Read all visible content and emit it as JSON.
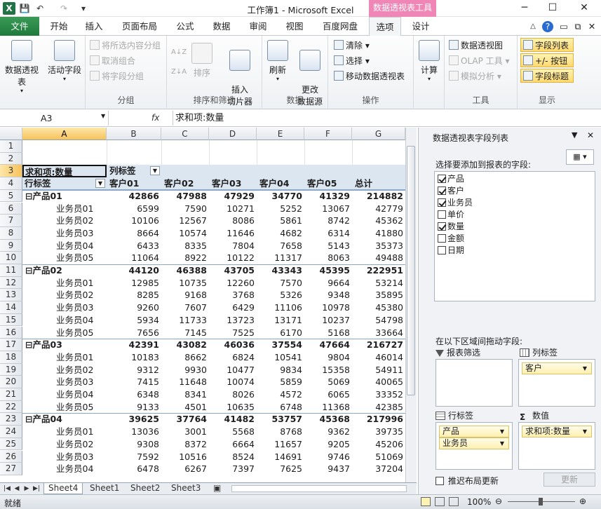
{
  "window": {
    "title": "工作簿1 - Microsoft Excel",
    "context_tab": "数据透视表工具",
    "win_min": "─",
    "win_max": "☐",
    "win_close": "✕"
  },
  "qat": {
    "save": "💾",
    "undo": "↶",
    "redo": "↷",
    "more": "▾"
  },
  "tabs": [
    "文件",
    "开始",
    "插入",
    "页面布局",
    "公式",
    "数据",
    "审阅",
    "视图",
    "百度网盘",
    "选项",
    "设计"
  ],
  "active_tab": "选项",
  "help_icons": [
    "△",
    "?",
    "▭",
    "⧉",
    "✕"
  ],
  "ribbon": {
    "pivot_table": {
      "label": "数据透视表"
    },
    "active_field": {
      "label": "活动字段"
    },
    "group": {
      "name": "分组",
      "items": [
        "将所选内容分组",
        "取消组合",
        "将字段分组"
      ]
    },
    "sort": {
      "name": "排序和筛选",
      "sort_label": "排序",
      "az": "A↓Z",
      "za": "Z↓A",
      "slicer": "插入\n切片器"
    },
    "data": {
      "name": "数据",
      "refresh": "刷新",
      "change_source": "更改\n数据源"
    },
    "ops": {
      "name": "操作",
      "items": [
        "清除",
        "选择",
        "移动数据透视表"
      ]
    },
    "calc": {
      "label": "计算"
    },
    "tools": {
      "name": "工具",
      "items": [
        "数据透视图",
        "OLAP 工具",
        "模拟分析"
      ]
    },
    "show": {
      "name": "显示",
      "items": [
        "字段列表",
        "+/- 按钮",
        "字段标题"
      ]
    }
  },
  "formula_bar": {
    "name_box": "A3",
    "fx": "fx",
    "formula": "求和项:数量"
  },
  "columns": [
    "A",
    "B",
    "C",
    "D",
    "E",
    "F",
    "G"
  ],
  "rows": [
    {
      "n": "1",
      "cells": []
    },
    {
      "n": "2",
      "cells": []
    },
    {
      "n": "3",
      "type": "title",
      "cells": [
        "求和项:数量",
        "列标签"
      ]
    },
    {
      "n": "4",
      "type": "header",
      "cells": [
        "行标签",
        "客户01",
        "客户02",
        "客户03",
        "客户04",
        "客户05",
        "总计"
      ]
    },
    {
      "n": "5",
      "type": "prod",
      "cells": [
        "⊟产品01",
        "42866",
        "47988",
        "47929",
        "34770",
        "41329",
        "214882"
      ]
    },
    {
      "n": "6",
      "cells": [
        "业务员01",
        "6599",
        "7590",
        "10271",
        "5252",
        "13067",
        "42779"
      ]
    },
    {
      "n": "7",
      "cells": [
        "业务员02",
        "10106",
        "12567",
        "8086",
        "5861",
        "8742",
        "45362"
      ]
    },
    {
      "n": "8",
      "cells": [
        "业务员03",
        "8664",
        "10574",
        "11646",
        "4682",
        "6314",
        "41880"
      ]
    },
    {
      "n": "9",
      "cells": [
        "业务员04",
        "6433",
        "8335",
        "7804",
        "7658",
        "5143",
        "35373"
      ]
    },
    {
      "n": "10",
      "cells": [
        "业务员05",
        "11064",
        "8922",
        "10122",
        "11317",
        "8063",
        "49488"
      ]
    },
    {
      "n": "11",
      "type": "prod",
      "cells": [
        "⊟产品02",
        "44120",
        "46388",
        "43705",
        "43343",
        "45395",
        "222951"
      ]
    },
    {
      "n": "12",
      "cells": [
        "业务员01",
        "12985",
        "10735",
        "12260",
        "7570",
        "9664",
        "53214"
      ]
    },
    {
      "n": "13",
      "cells": [
        "业务员02",
        "8285",
        "9168",
        "3768",
        "5326",
        "9348",
        "35895"
      ]
    },
    {
      "n": "14",
      "cells": [
        "业务员03",
        "9260",
        "7607",
        "6429",
        "11106",
        "10978",
        "45380"
      ]
    },
    {
      "n": "15",
      "cells": [
        "业务员04",
        "5934",
        "11733",
        "13723",
        "13171",
        "10237",
        "54798"
      ]
    },
    {
      "n": "16",
      "cells": [
        "业务员05",
        "7656",
        "7145",
        "7525",
        "6170",
        "5168",
        "33664"
      ]
    },
    {
      "n": "17",
      "type": "prod",
      "cells": [
        "⊟产品03",
        "42391",
        "43082",
        "46036",
        "37554",
        "47664",
        "216727"
      ]
    },
    {
      "n": "18",
      "cells": [
        "业务员01",
        "10183",
        "8662",
        "6824",
        "10541",
        "9804",
        "46014"
      ]
    },
    {
      "n": "19",
      "cells": [
        "业务员02",
        "9312",
        "9930",
        "10477",
        "9834",
        "15358",
        "54911"
      ]
    },
    {
      "n": "20",
      "cells": [
        "业务员03",
        "7415",
        "11648",
        "10074",
        "5859",
        "5069",
        "40065"
      ]
    },
    {
      "n": "21",
      "cells": [
        "业务员04",
        "6348",
        "8341",
        "8026",
        "4572",
        "6065",
        "33352"
      ]
    },
    {
      "n": "22",
      "cells": [
        "业务员05",
        "9133",
        "4501",
        "10635",
        "6748",
        "11368",
        "42385"
      ]
    },
    {
      "n": "23",
      "type": "prod",
      "cells": [
        "⊟产品04",
        "39625",
        "37764",
        "41482",
        "53757",
        "45368",
        "217996"
      ]
    },
    {
      "n": "24",
      "cells": [
        "业务员01",
        "13036",
        "3001",
        "5568",
        "8768",
        "9362",
        "39735"
      ]
    },
    {
      "n": "25",
      "cells": [
        "业务员02",
        "9308",
        "8372",
        "6664",
        "11657",
        "9205",
        "45206"
      ]
    },
    {
      "n": "26",
      "cells": [
        "业务员03",
        "7592",
        "10516",
        "8524",
        "14691",
        "9746",
        "51069"
      ]
    },
    {
      "n": "27",
      "cells": [
        "业务员04",
        "6478",
        "6267",
        "7397",
        "7625",
        "9437",
        "37204"
      ]
    }
  ],
  "sheets": [
    "Sheet4",
    "Sheet1",
    "Sheet2",
    "Sheet3"
  ],
  "active_sheet": "Sheet4",
  "status": {
    "ready": "就绪",
    "zoom": "100%"
  },
  "pivot_pane": {
    "title": "数据透视表字段列表",
    "choose_label": "选择要添加到报表的字段:",
    "fields": [
      {
        "name": "产品",
        "checked": true
      },
      {
        "name": "客户",
        "checked": true
      },
      {
        "name": "业务员",
        "checked": true
      },
      {
        "name": "单价",
        "checked": false
      },
      {
        "name": "数量",
        "checked": true
      },
      {
        "name": "金额",
        "checked": false
      },
      {
        "name": "日期",
        "checked": false
      }
    ],
    "drag_label": "在以下区域间拖动字段:",
    "filter_label": "报表筛选",
    "col_label": "列标签",
    "row_label": "行标签",
    "values_label": "数值",
    "col_items": [
      "客户"
    ],
    "row_items": [
      "产品",
      "业务员"
    ],
    "value_items": [
      "求和项:数量"
    ],
    "defer_label": "推迟布局更新",
    "update_label": "更新"
  }
}
